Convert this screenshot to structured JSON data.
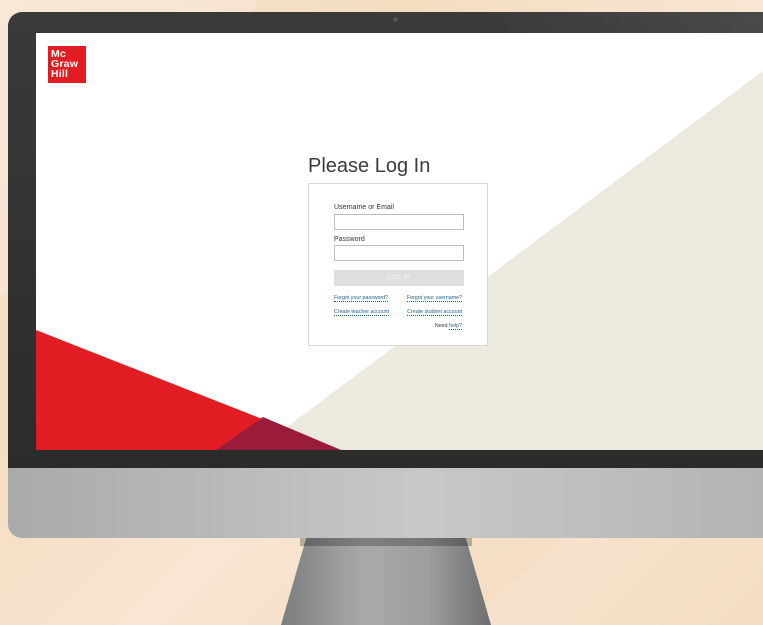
{
  "brand": {
    "logo_lines": [
      "Mc",
      "Graw",
      "Hill"
    ],
    "logo_color": "#e21c23"
  },
  "login": {
    "title": "Please Log In",
    "username_label": "Username or Email",
    "username_value": "",
    "password_label": "Password",
    "password_value": "",
    "submit_label": "LOG IN"
  },
  "links": {
    "forgot_password": "Forgot your password?",
    "forgot_username": "Forgot your username?",
    "create_teacher": "Create teacher account",
    "create_student": "Create student account",
    "need_help_prefix": "Need",
    "help_link": "help?"
  },
  "colors": {
    "accent_red": "#e21c23",
    "dark_red": "#9b1b3a",
    "beige": "#eceadf",
    "link_blue": "#1f5d8c"
  }
}
